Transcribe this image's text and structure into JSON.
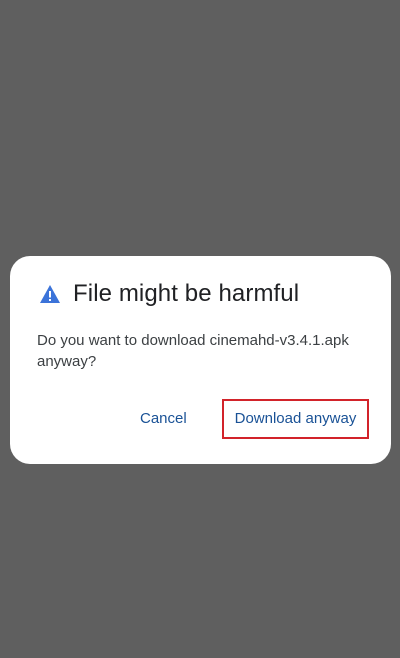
{
  "dialog": {
    "title": "File might be harmful",
    "message": "Do you want to download cinemahd-v3.4.1.apk anyway?",
    "cancel_label": "Cancel",
    "download_label": "Download anyway"
  },
  "icons": {
    "title_icon": "warning-icon"
  },
  "colors": {
    "backdrop": "#5f5f5f",
    "accent": "#1a5296",
    "warning": "#3b73d9",
    "highlight": "#d2232a"
  }
}
